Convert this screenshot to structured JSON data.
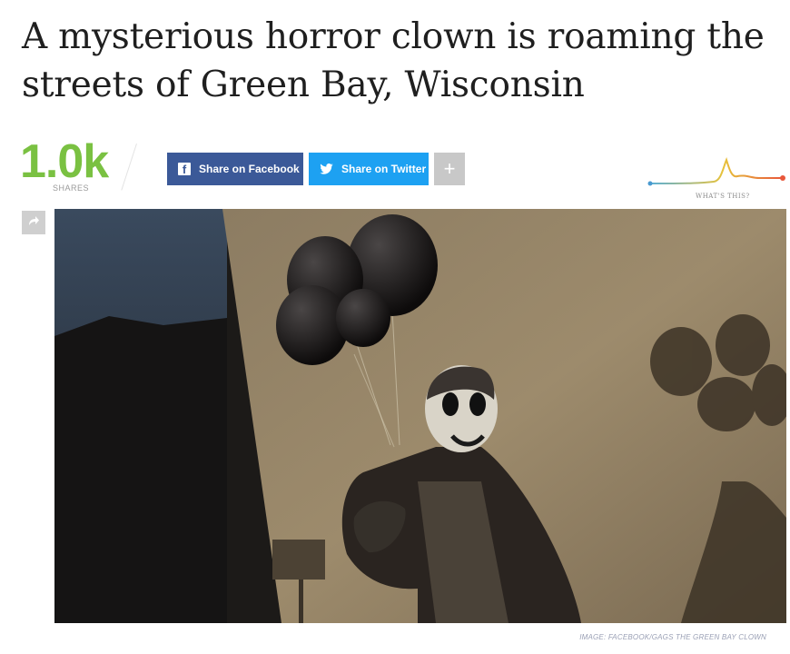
{
  "article": {
    "headline": "A mysterious horror clown is roaming the streets of Green Bay, Wisconsin",
    "image_credit": "IMAGE: FACEBOOK/GAGS THE GREEN BAY CLOWN"
  },
  "share_bar": {
    "count": "1.0k",
    "count_label": "SHARES",
    "facebook_label": "Share on Facebook",
    "twitter_label": "Share on Twitter",
    "more_label": "+",
    "trend_label": "WHAT'S THIS?"
  },
  "colors": {
    "share_count": "#7ac142",
    "facebook": "#3b5998",
    "twitter": "#1da1f2",
    "more": "#c8c8c8"
  },
  "icons": {
    "facebook": "facebook-icon",
    "twitter": "twitter-icon",
    "share_arrow": "share-arrow-icon"
  }
}
